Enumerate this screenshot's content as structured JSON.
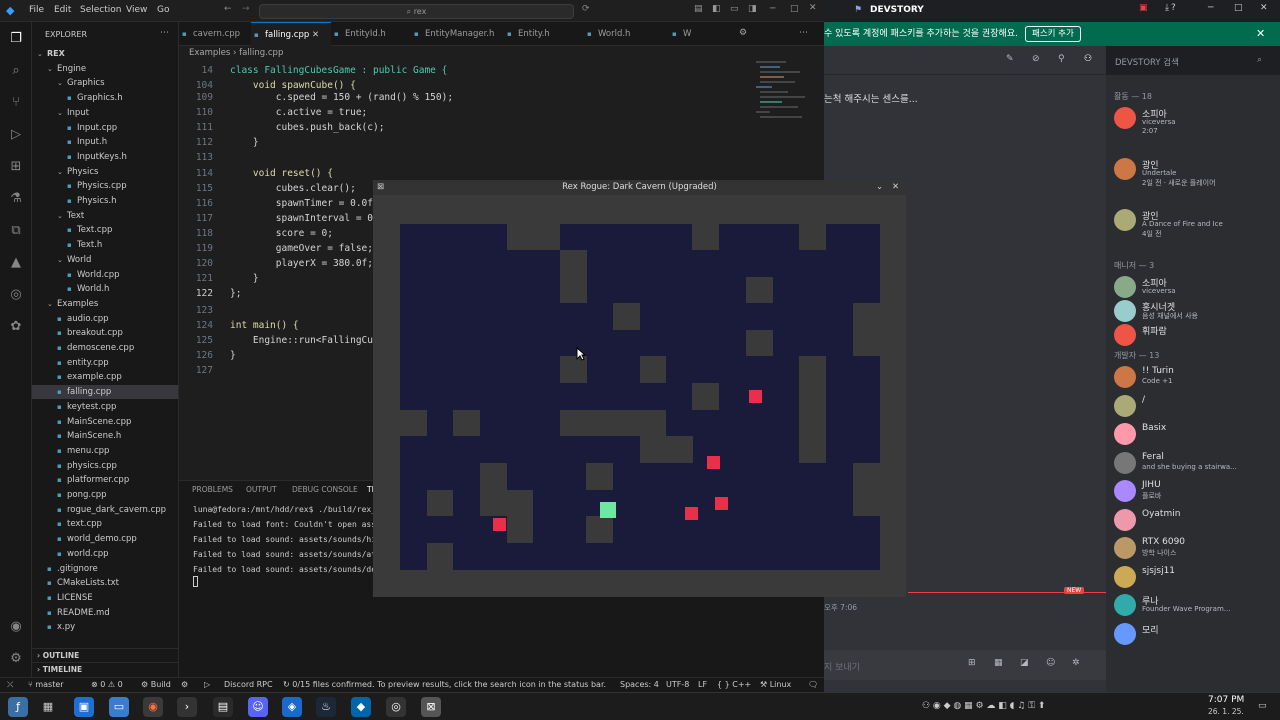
{
  "vscode": {
    "menu": [
      "File",
      "Edit",
      "Selection",
      "View",
      "Go"
    ],
    "search_text": "rex",
    "sidebar_title": "EXPLORER",
    "tree": [
      {
        "label": "REX",
        "indent": 0,
        "type": "root"
      },
      {
        "label": "Engine",
        "indent": 1,
        "type": "folder"
      },
      {
        "label": "Graphics",
        "indent": 2,
        "type": "folder"
      },
      {
        "label": "Graphics.h",
        "indent": 3,
        "type": "file"
      },
      {
        "label": "Input",
        "indent": 2,
        "type": "folder"
      },
      {
        "label": "Input.cpp",
        "indent": 3,
        "type": "file"
      },
      {
        "label": "Input.h",
        "indent": 3,
        "type": "file"
      },
      {
        "label": "InputKeys.h",
        "indent": 3,
        "type": "file"
      },
      {
        "label": "Physics",
        "indent": 2,
        "type": "folder"
      },
      {
        "label": "Physics.cpp",
        "indent": 3,
        "type": "file"
      },
      {
        "label": "Physics.h",
        "indent": 3,
        "type": "file"
      },
      {
        "label": "Text",
        "indent": 2,
        "type": "folder"
      },
      {
        "label": "Text.cpp",
        "indent": 3,
        "type": "file"
      },
      {
        "label": "Text.h",
        "indent": 3,
        "type": "file"
      },
      {
        "label": "World",
        "indent": 2,
        "type": "folder"
      },
      {
        "label": "World.cpp",
        "indent": 3,
        "type": "file"
      },
      {
        "label": "World.h",
        "indent": 3,
        "type": "file"
      },
      {
        "label": "Examples",
        "indent": 1,
        "type": "folder"
      },
      {
        "label": "audio.cpp",
        "indent": 2,
        "type": "file"
      },
      {
        "label": "breakout.cpp",
        "indent": 2,
        "type": "file"
      },
      {
        "label": "demoscene.cpp",
        "indent": 2,
        "type": "file"
      },
      {
        "label": "entity.cpp",
        "indent": 2,
        "type": "file"
      },
      {
        "label": "example.cpp",
        "indent": 2,
        "type": "file"
      },
      {
        "label": "falling.cpp",
        "indent": 2,
        "type": "file",
        "selected": true
      },
      {
        "label": "keytest.cpp",
        "indent": 2,
        "type": "file"
      },
      {
        "label": "MainScene.cpp",
        "indent": 2,
        "type": "file"
      },
      {
        "label": "MainScene.h",
        "indent": 2,
        "type": "file"
      },
      {
        "label": "menu.cpp",
        "indent": 2,
        "type": "file"
      },
      {
        "label": "physics.cpp",
        "indent": 2,
        "type": "file"
      },
      {
        "label": "platformer.cpp",
        "indent": 2,
        "type": "file"
      },
      {
        "label": "pong.cpp",
        "indent": 2,
        "type": "file"
      },
      {
        "label": "rogue_dark_cavern.cpp",
        "indent": 2,
        "type": "file"
      },
      {
        "label": "text.cpp",
        "indent": 2,
        "type": "file"
      },
      {
        "label": "world_demo.cpp",
        "indent": 2,
        "type": "file"
      },
      {
        "label": "world.cpp",
        "indent": 2,
        "type": "file"
      },
      {
        "label": ".gitignore",
        "indent": 1,
        "type": "file"
      },
      {
        "label": "CMakeLists.txt",
        "indent": 1,
        "type": "file"
      },
      {
        "label": "LICENSE",
        "indent": 1,
        "type": "file"
      },
      {
        "label": "README.md",
        "indent": 1,
        "type": "file"
      },
      {
        "label": "x.py",
        "indent": 1,
        "type": "file"
      }
    ],
    "outline_label": "OUTLINE",
    "timeline_label": "TIMELINE",
    "tabs": [
      {
        "label": "cavern.cpp",
        "active": false
      },
      {
        "label": "falling.cpp",
        "active": true
      },
      {
        "label": "EntityId.h",
        "active": false
      },
      {
        "label": "EntityManager.h",
        "active": false
      },
      {
        "label": "Entity.h",
        "active": false
      },
      {
        "label": "World.h",
        "active": false
      },
      {
        "label": "W",
        "active": false
      }
    ],
    "breadcrumb": "Examples  ›  falling.cpp",
    "code": [
      {
        "n": "14",
        "t": "class FallingCubesGame : public Game {"
      },
      {
        "n": "104",
        "t": "    void spawnCube() {"
      },
      {
        "n": "109",
        "t": "        c.speed = 150 + (rand() % 150);"
      },
      {
        "n": "110",
        "t": "        c.active = true;"
      },
      {
        "n": "111",
        "t": "        cubes.push_back(c);"
      },
      {
        "n": "112",
        "t": "    }"
      },
      {
        "n": "113",
        "t": ""
      },
      {
        "n": "114",
        "t": "    void reset() {"
      },
      {
        "n": "115",
        "t": "        cubes.clear();"
      },
      {
        "n": "116",
        "t": "        spawnTimer = 0.0f"
      },
      {
        "n": "117",
        "t": "        spawnInterval = 0"
      },
      {
        "n": "118",
        "t": "        score = 0;"
      },
      {
        "n": "119",
        "t": "        gameOver = false;"
      },
      {
        "n": "120",
        "t": "        playerX = 380.0f;"
      },
      {
        "n": "121",
        "t": "    }"
      },
      {
        "n": "122",
        "t": "};"
      },
      {
        "n": "123",
        "t": ""
      },
      {
        "n": "124",
        "t": "int main() {"
      },
      {
        "n": "125",
        "t": "    Engine::run<FallingCub"
      },
      {
        "n": "126",
        "t": "}"
      },
      {
        "n": "127",
        "t": ""
      }
    ],
    "panel_tabs": [
      "PROBLEMS",
      "OUTPUT",
      "DEBUG CONSOLE",
      "TI"
    ],
    "terminal": [
      "luna@fedora:/mnt/hdd/rex$ ./build/rex_rogue_d",
      "Failed to load font: Couldn't open assets/fon",
      "Failed to load sound: assets/sounds/hit.wav (",
      "Failed to load sound: assets/sounds/attack.wa",
      "Failed to load sound: assets/sounds/dead.wav"
    ],
    "status": {
      "branch": "master",
      "errors": "⊗ 0 ⚠ 0",
      "build": "Build",
      "discord": "Discord RPC",
      "message": "0/15 files confirmed. To preview results, click the search icon in the status bar.",
      "spaces": "Spaces: 4",
      "encoding": "UTF-8",
      "eol": "LF",
      "lang": "C++",
      "os": "Linux"
    }
  },
  "game": {
    "title": "Rex Rogue: Dark Cavern (Upgraded)",
    "floor_color": "#1a1a3a",
    "wall_color": "#3a3a3a",
    "enemy_color": "#e8304a",
    "player_color": "#6ee7a0"
  },
  "discord": {
    "app_name": "DEVSTORY",
    "banner_text": "수 있도록 계정에 패스키를 추가하는 것을 권장해요.",
    "banner_button": "패스키 추가",
    "search_placeholder": "DEVSTORY 검색",
    "chat_snippet": "는척 해주시는 센스를...",
    "chat_time": "오후 7:06",
    "new_badge": "NEW",
    "chat_input": "지 보내기",
    "section_active": "활동 — 18",
    "active_members": [
      {
        "name": "소피아",
        "sub": "viceversa",
        "sub2": "2:07"
      },
      {
        "name": "광인",
        "sub": "Undertale",
        "sub2": "2일 전 · 새로운 플레이어"
      },
      {
        "name": "광인",
        "sub": "A Dance of Fire and Ice",
        "sub2": "4일 전"
      }
    ],
    "section_mgr": "매니저 — 3",
    "managers": [
      {
        "name": "소피아",
        "sub": "viceversa"
      },
      {
        "name": "홍시너겟",
        "sub": "음성 채널에서 사용"
      },
      {
        "name": "휘파람",
        "sub": ""
      }
    ],
    "section_dev": "개발자 — 13",
    "devs": [
      {
        "name": "!! Turin",
        "sub": "Code +1"
      },
      {
        "name": "/",
        "sub": ""
      },
      {
        "name": "Basix",
        "sub": ""
      },
      {
        "name": "Feral",
        "sub": "and she buying a stairwa..."
      },
      {
        "name": "JIHU",
        "sub": "플로바"
      },
      {
        "name": "Oyatmin",
        "sub": ""
      },
      {
        "name": "RTX 6090",
        "sub": "방학 나이스"
      },
      {
        "name": "sjsjsj11",
        "sub": ""
      },
      {
        "name": "루나",
        "sub": "Founder Wave Program..."
      },
      {
        "name": "모리",
        "sub": ""
      }
    ]
  },
  "taskbar": {
    "time": "7:07 PM",
    "date": "26. 1. 25."
  }
}
